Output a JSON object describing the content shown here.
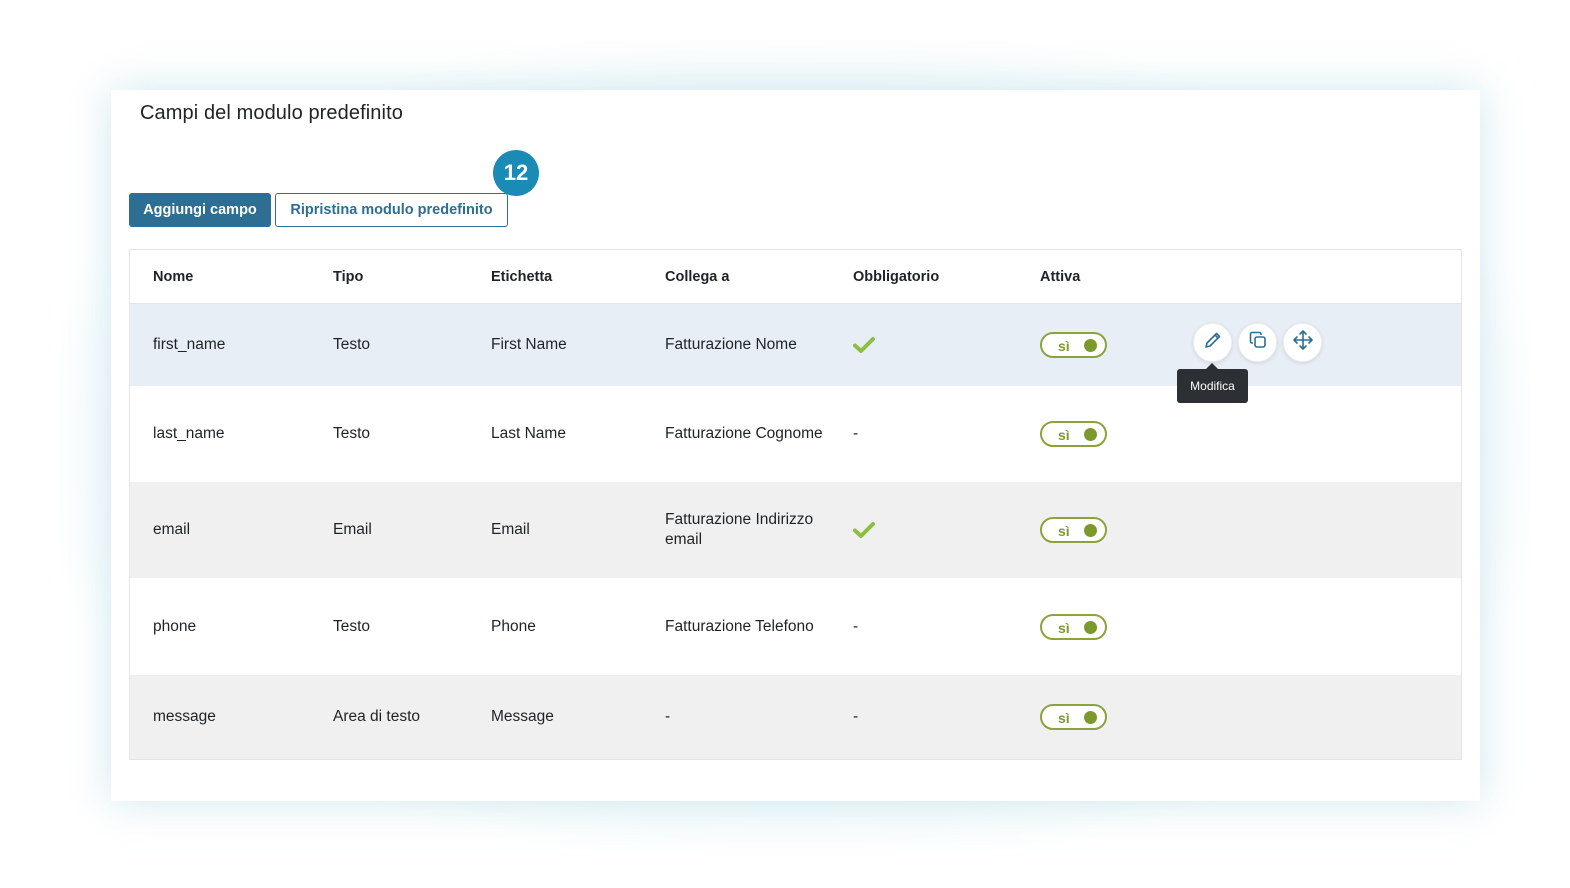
{
  "panel": {
    "title": "Campi del modulo predefinito"
  },
  "toolbar": {
    "add_label": "Aggiungi campo",
    "reset_label": "Ripristina modulo predefinito",
    "step_badge": "12"
  },
  "table": {
    "headers": [
      "Nome",
      "Tipo",
      "Etichetta",
      "Collega a",
      "Obbligatorio",
      "Attiva"
    ],
    "rows": [
      {
        "name": "first_name",
        "type": "Testo",
        "label": "First Name",
        "link": "Fatturazione Nome",
        "required": true,
        "required_text": "",
        "active_label": "sì"
      },
      {
        "name": "last_name",
        "type": "Testo",
        "label": "Last Name",
        "link": "Fatturazione Cognome",
        "required": false,
        "required_text": "-",
        "active_label": "sì"
      },
      {
        "name": "email",
        "type": "Email",
        "label": "Email",
        "link": "Fatturazione Indirizzo email",
        "required": true,
        "required_text": "",
        "active_label": "sì"
      },
      {
        "name": "phone",
        "type": "Testo",
        "label": "Phone",
        "link": "Fatturazione Telefono",
        "required": false,
        "required_text": "-",
        "active_label": "sì"
      },
      {
        "name": "message",
        "type": "Area di testo",
        "label": "Message",
        "link": "-",
        "required": false,
        "required_text": "-",
        "active_label": "sì"
      }
    ],
    "row_actions": {
      "icons": [
        "pencil-icon",
        "duplicate-icon",
        "move-icon"
      ],
      "tooltip": "Modifica"
    }
  },
  "colors": {
    "primary": "#2f6e93",
    "badge": "#1a8bb5",
    "toggle": "#7c9a2c",
    "check": "#8cbf3f"
  }
}
